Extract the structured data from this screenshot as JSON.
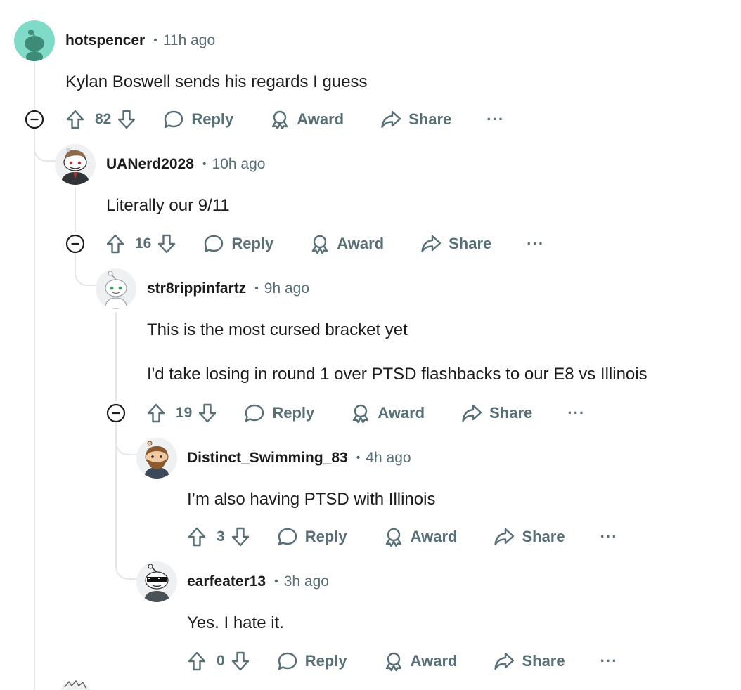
{
  "labels": {
    "reply": "Reply",
    "award": "Award",
    "share": "Share",
    "more": "···"
  },
  "comments": [
    {
      "user": "hotspencer",
      "time": "11h ago",
      "lines": [
        "Kylan Boswell sends his regards I guess"
      ],
      "votes": "82"
    },
    {
      "user": "UANerd2028",
      "time": "10h ago",
      "lines": [
        "Literally our 9/11"
      ],
      "votes": "16"
    },
    {
      "user": "str8rippinfartz",
      "time": "9h ago",
      "lines": [
        "This is the most cursed bracket yet",
        "I'd take losing in round 1 over PTSD flashbacks to our E8 vs Illinois"
      ],
      "votes": "19"
    },
    {
      "user": "Distinct_Swimming_83",
      "time": "4h ago",
      "lines": [
        "I’m also having PTSD with Illinois"
      ],
      "votes": "3"
    },
    {
      "user": "earfeater13",
      "time": "3h ago",
      "lines": [
        "Yes. I hate it."
      ],
      "votes": "0"
    }
  ],
  "colors": {
    "muted": "#576f76",
    "text": "#1c1c1c",
    "thread": "#e5e7ea",
    "snoo_bg_teal": "#7fdbc7"
  }
}
